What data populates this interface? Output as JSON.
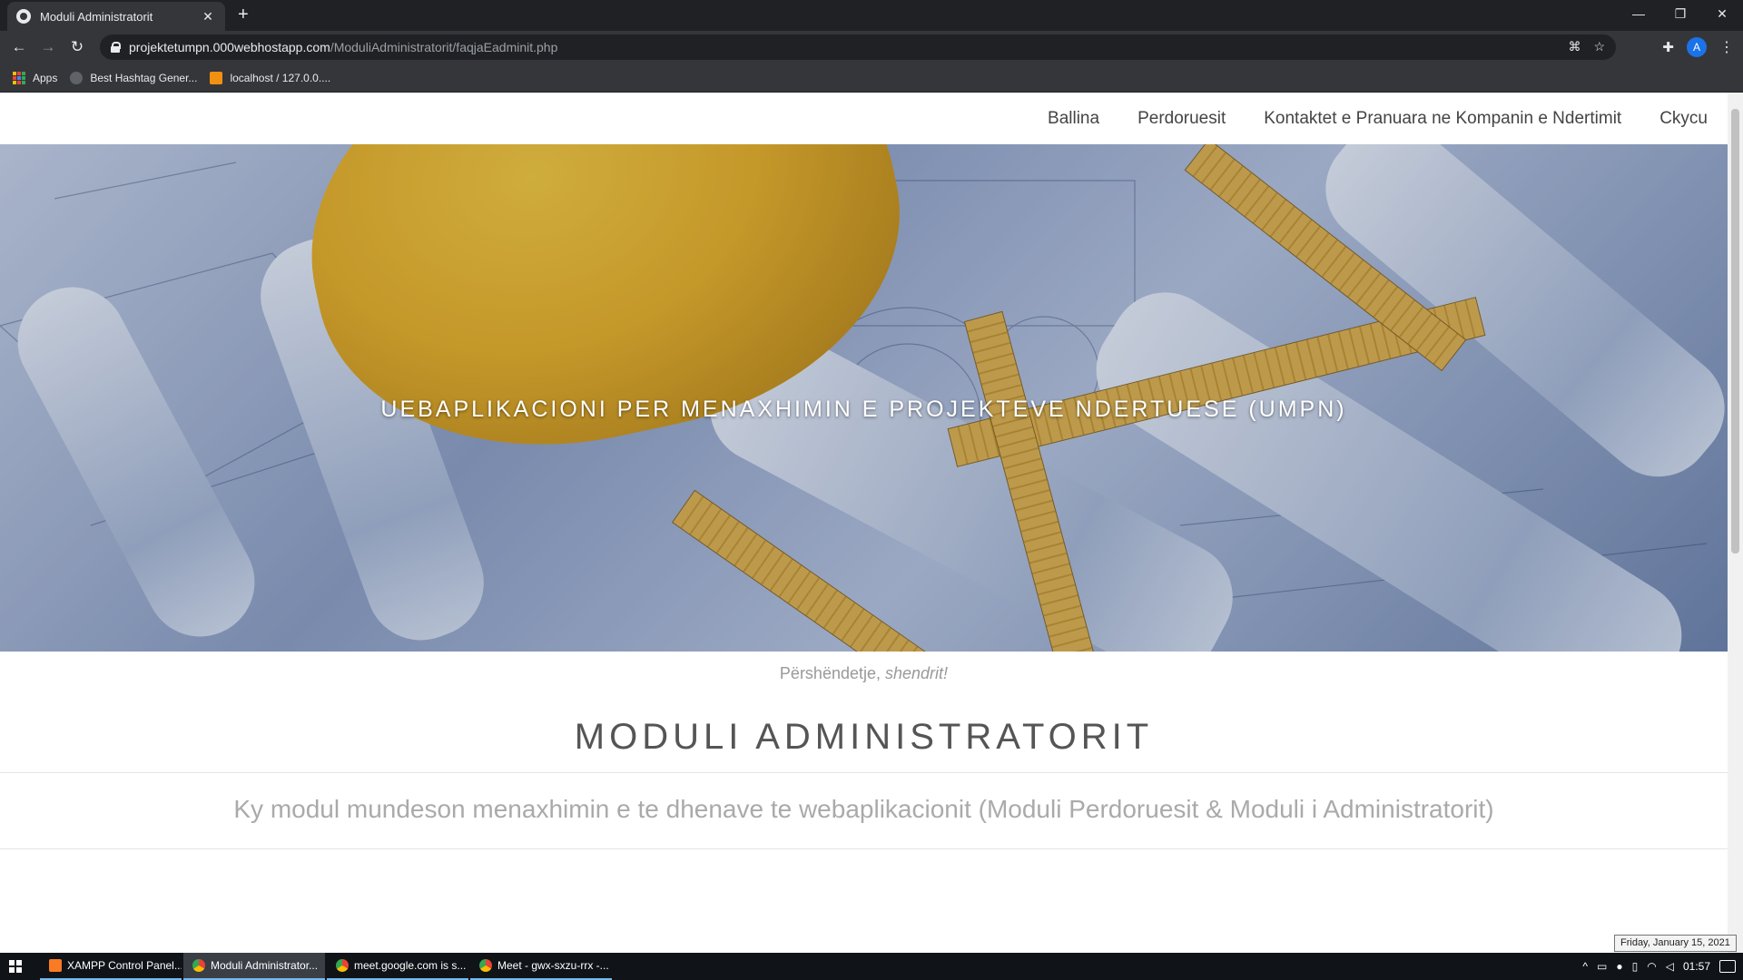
{
  "browser": {
    "tab_title": "Moduli Administratorit",
    "url_host": "projektetumpn.000webhostapp.com",
    "url_path": "/ModuliAdministratorit/faqjaEadminit.php",
    "profile_initial": "A",
    "bookmarks": [
      {
        "label": "Apps",
        "icon": "apps-grid-icon"
      },
      {
        "label": "Best Hashtag Gener...",
        "icon": "hashtag-icon"
      },
      {
        "label": "localhost / 127.0.0....",
        "icon": "phpmyadmin-icon"
      }
    ]
  },
  "site": {
    "nav": [
      "Ballina",
      "Perdoruesit",
      "Kontaktet e Pranuara ne Kompanin e Ndertimit",
      "Ckycu"
    ],
    "hero_title": "UEBAPLIKACIONI PER MENAXHIMIN E PROJEKTEVE NDERTUESE (UMPN)",
    "greeting_prefix": "Përshëndetje,",
    "greeting_user": "shendrit!",
    "module_title": "MODULI ADMINISTRATORIT",
    "module_desc": "Ky modul mundeson menaxhimin e te dhenave te webaplikacionit (Moduli Perdoruesit & Moduli i Administratorit)"
  },
  "taskbar": {
    "items": [
      {
        "label": "XAMPP Control Panel...",
        "icon": "xampp-icon",
        "active": false
      },
      {
        "label": "Moduli Administrator...",
        "icon": "chrome-icon",
        "active": true
      },
      {
        "label": "meet.google.com is s...",
        "icon": "chrome-icon",
        "active": false
      },
      {
        "label": "Meet - gwx-sxzu-rrx -...",
        "icon": "chrome-icon",
        "active": false
      }
    ],
    "time": "01:57",
    "date_tooltip": "Friday, January 15, 2021"
  }
}
